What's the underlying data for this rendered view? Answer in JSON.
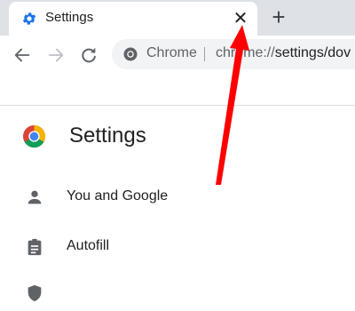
{
  "tab": {
    "title": "Settings",
    "close_symbol": "✕"
  },
  "new_tab_symbol": "+",
  "omnibox": {
    "chip": "Chrome",
    "url_host": "chrome://",
    "url_path": "settings/dov"
  },
  "page": {
    "title": "Settings"
  },
  "nav_items": [
    {
      "label": "You and Google",
      "icon": "person-icon"
    },
    {
      "label": "Autofill",
      "icon": "clipboard-icon"
    },
    {
      "label": "",
      "icon": "shield-icon"
    }
  ],
  "colors": {
    "accent": "#1a73e8",
    "annotation_arrow": "#ff0000"
  }
}
